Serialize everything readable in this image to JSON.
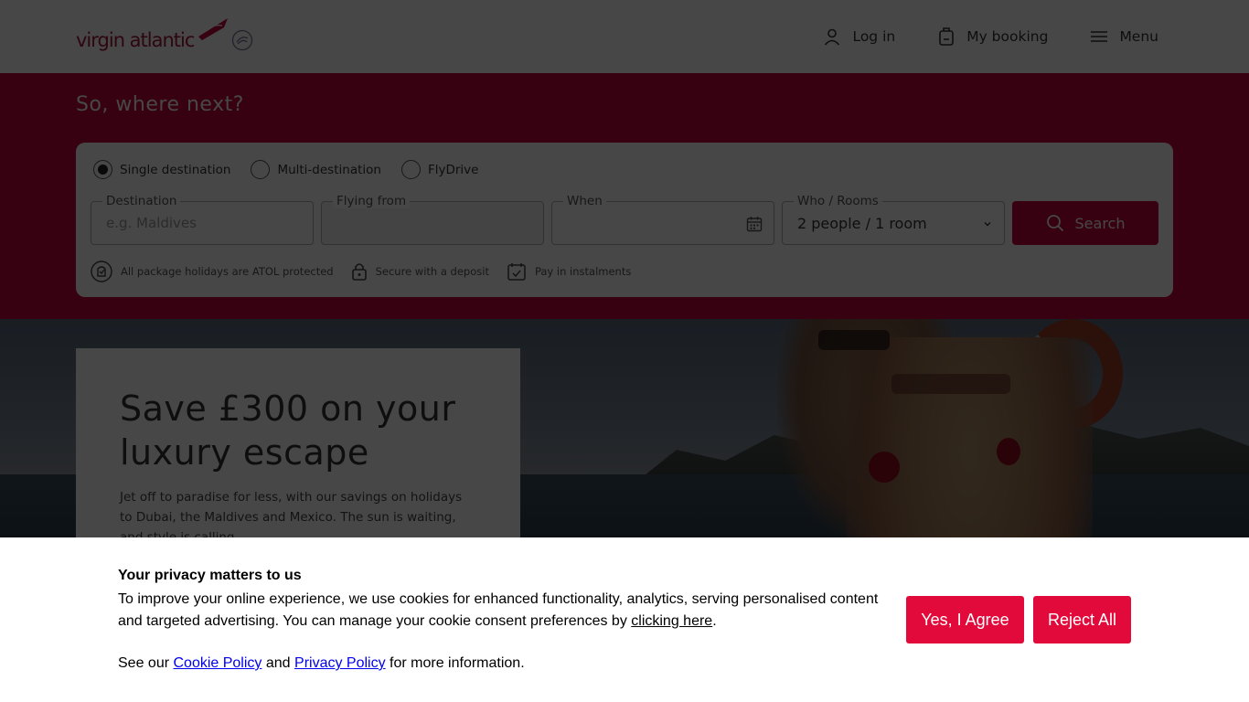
{
  "header": {
    "logo_text": "virgin atlantic",
    "nav": {
      "login_label": "Log in",
      "booking_label": "My booking",
      "menu_label": "Menu"
    }
  },
  "search": {
    "title": "So, where next?",
    "trip_types": [
      {
        "label": "Single destination",
        "selected": true
      },
      {
        "label": "Multi-destination",
        "selected": false
      },
      {
        "label": "FlyDrive",
        "selected": false
      }
    ],
    "destination": {
      "label": "Destination",
      "placeholder": "e.g. Maldives",
      "value": ""
    },
    "flying_from": {
      "label": "Flying from",
      "value": ""
    },
    "when": {
      "label": "When",
      "value": ""
    },
    "who_rooms": {
      "label": "Who / Rooms",
      "value": "2 people / 1 room"
    },
    "search_label": "Search",
    "features": [
      {
        "icon": "atol-icon",
        "label": "All package holidays are ATOL protected"
      },
      {
        "icon": "lock-icon",
        "label": "Secure with a deposit"
      },
      {
        "icon": "instalments-icon",
        "label": "Pay in instalments"
      }
    ]
  },
  "promo": {
    "title": "Save £300 on your luxury escape",
    "body": "Jet off to paradise for less, with our savings on holidays to Dubai, the Maldives and Mexico. The sun is waiting, and style is calling."
  },
  "cookie": {
    "title": "Your privacy matters to us",
    "text_before_link": "To improve your online experience, we use cookies for enhanced functionality, analytics, serving personalised content and targeted advertising. You can manage your cookie consent preferences by ",
    "manage_link": "clicking here",
    "text_after_link": ".",
    "see_our": "See our ",
    "cookie_policy_link": "Cookie Policy",
    "and": " and ",
    "privacy_policy_link": "Privacy Policy",
    "more_info": " for more information.",
    "agree_label": "Yes, I Agree",
    "reject_label": "Reject All"
  },
  "colors": {
    "brand_red": "#c4063d",
    "cookie_button": "#e10a3b",
    "link_blue": "#0000ee"
  }
}
